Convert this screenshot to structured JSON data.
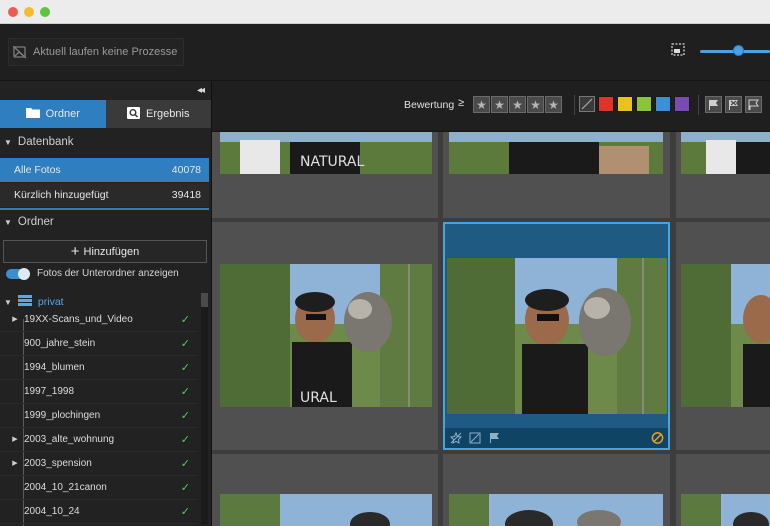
{
  "toolbar": {
    "status": "Aktuell laufen keine Prozesse",
    "zoom_level": 0.47
  },
  "sidebar": {
    "collapse_glyph": "◂◂",
    "tabs": [
      {
        "label": "Ordner",
        "icon": "folder-icon",
        "active": true
      },
      {
        "label": "Ergebnis",
        "icon": "search-icon",
        "active": false
      }
    ],
    "database": {
      "header": "Datenbank",
      "rows": [
        {
          "label": "Alle Fotos",
          "count": "40078",
          "active": true
        },
        {
          "label": "Kürzlich hinzugefügt",
          "count": "39418",
          "active": false
        }
      ]
    },
    "folders": {
      "header": "Ordner",
      "add_label": "Hinzufügen",
      "toggle_label": "Fotos der Unterordner anzeigen",
      "toggle_on": true,
      "root": "privat",
      "items": [
        {
          "label": "19XX-Scans_und_Video",
          "expandable": true
        },
        {
          "label": "900_jahre_stein",
          "expandable": false
        },
        {
          "label": "1994_blumen",
          "expandable": false
        },
        {
          "label": "1997_1998",
          "expandable": false
        },
        {
          "label": "1999_plochingen",
          "expandable": false
        },
        {
          "label": "2003_alte_wohnung",
          "expandable": true
        },
        {
          "label": "2003_spension",
          "expandable": true
        },
        {
          "label": "2004_10_21canon",
          "expandable": false
        },
        {
          "label": "2004_10_24",
          "expandable": false
        }
      ]
    }
  },
  "filter": {
    "rating_label": "Bewertung",
    "rating_operator": "≥",
    "stars": 5,
    "color_labels": [
      "#e0342a",
      "#e8c21d",
      "#8cc43c",
      "#3d8fd8",
      "#7a4bb3"
    ],
    "accent": "#2f7fc0"
  }
}
